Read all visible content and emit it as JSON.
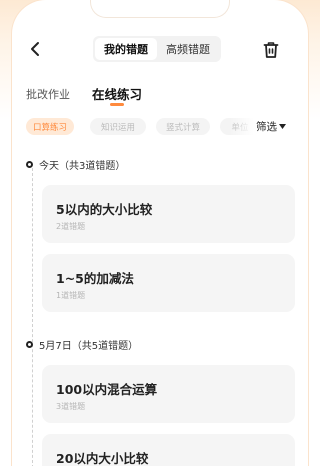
{
  "nav": {
    "back_icon": "chevron-left-icon",
    "segments": [
      {
        "label": "我的错题",
        "active": true
      },
      {
        "label": "高频错题",
        "active": false
      }
    ],
    "trash_icon": "trash-icon"
  },
  "tabs": [
    {
      "label": "批改作业",
      "active": false
    },
    {
      "label": "在线练习",
      "active": true
    }
  ],
  "chips": [
    {
      "label": "口算练习",
      "active": true
    },
    {
      "label": "知识运用",
      "active": false
    },
    {
      "label": "竖式计算",
      "active": false
    },
    {
      "label": "单位",
      "active": false
    }
  ],
  "filter": {
    "label": "筛选",
    "icon": "caret-down-icon"
  },
  "colors": {
    "accent": "#ff8a3d",
    "chip_active_bg": "#ffe9d6",
    "card_bg": "#f5f5f5"
  },
  "groups": [
    {
      "header": "今天（共3道错题）",
      "items": [
        {
          "title": "5以内的大小比较",
          "count": "2道错题"
        },
        {
          "title": "1~5的加减法",
          "count": "1道错题"
        }
      ]
    },
    {
      "header": "5月7日（共5道错题）",
      "items": [
        {
          "title": "100以内混合运算",
          "count": "3道错题"
        },
        {
          "title": "20以内大小比较",
          "count": ""
        }
      ]
    }
  ]
}
